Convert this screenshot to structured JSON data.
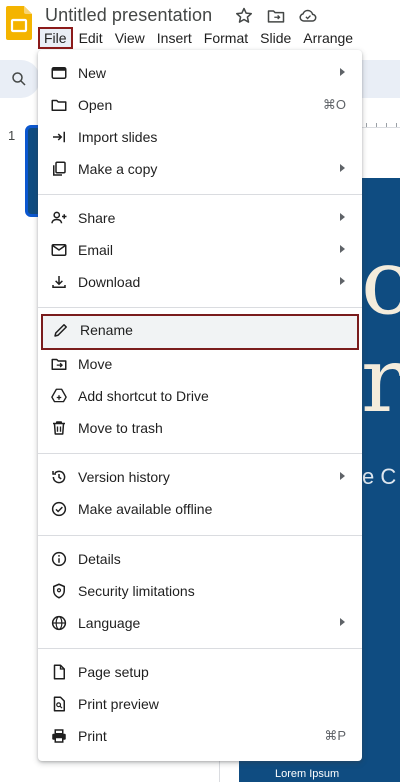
{
  "header": {
    "title": "Untitled presentation",
    "menus": [
      "File",
      "Edit",
      "View",
      "Insert",
      "Format",
      "Slide",
      "Arrange"
    ],
    "active_menu": "File"
  },
  "background": {
    "slide_number": "1",
    "slide_text_large_1": "c",
    "slide_text_large_2": "r",
    "slide_text_sub": "e C",
    "slide_footer": "Lorem Ipsum",
    "slide_color": "#0f4c81"
  },
  "file_menu": {
    "new": {
      "label": "New",
      "icon": "new-slides-icon",
      "submenu": true
    },
    "open": {
      "label": "Open",
      "icon": "folder-icon",
      "shortcut": "⌘O"
    },
    "import_slides": {
      "label": "Import slides",
      "icon": "import-icon"
    },
    "make_copy": {
      "label": "Make a copy",
      "icon": "copy-icon",
      "submenu": true
    },
    "share": {
      "label": "Share",
      "icon": "person-add-icon",
      "submenu": true
    },
    "email": {
      "label": "Email",
      "icon": "mail-icon",
      "submenu": true
    },
    "download": {
      "label": "Download",
      "icon": "download-icon",
      "submenu": true
    },
    "rename": {
      "label": "Rename",
      "icon": "pencil-icon",
      "highlighted": true
    },
    "move": {
      "label": "Move",
      "icon": "move-folder-icon"
    },
    "add_shortcut": {
      "label": "Add shortcut to Drive",
      "icon": "drive-shortcut-icon"
    },
    "trash": {
      "label": "Move to trash",
      "icon": "trash-icon"
    },
    "version_history": {
      "label": "Version history",
      "icon": "history-icon",
      "submenu": true
    },
    "offline": {
      "label": "Make available offline",
      "icon": "offline-check-icon"
    },
    "details": {
      "label": "Details",
      "icon": "info-icon"
    },
    "security": {
      "label": "Security limitations",
      "icon": "shield-icon"
    },
    "language": {
      "label": "Language",
      "icon": "globe-icon",
      "submenu": true
    },
    "page_setup": {
      "label": "Page setup",
      "icon": "page-icon"
    },
    "print_preview": {
      "label": "Print preview",
      "icon": "print-preview-icon"
    },
    "print": {
      "label": "Print",
      "icon": "printer-icon",
      "shortcut": "⌘P"
    }
  },
  "colors": {
    "highlight_border": "#7a1c1c",
    "slides_brand": "#f4b400",
    "accent": "#0b57d0"
  }
}
